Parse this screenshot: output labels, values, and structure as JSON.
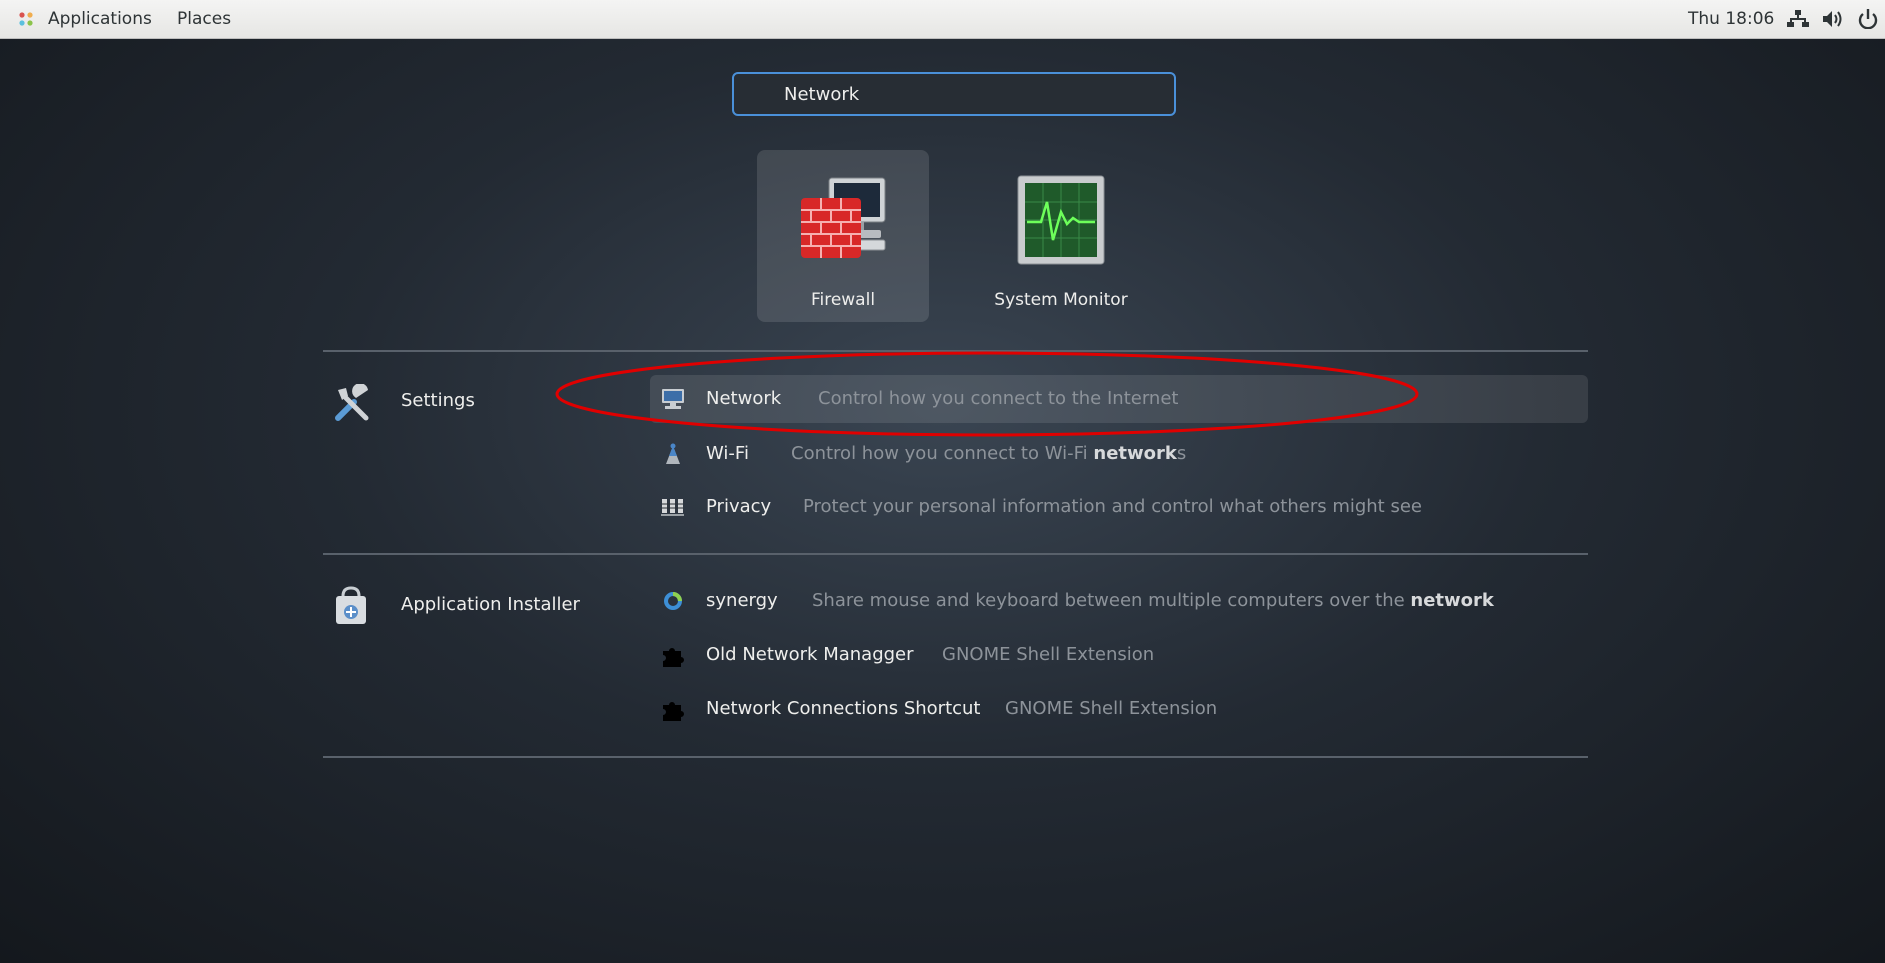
{
  "topbar": {
    "applications_label": "Applications",
    "places_label": "Places",
    "clock": "Thu 18:06"
  },
  "search": {
    "value": "Network"
  },
  "apps": [
    {
      "label": "Firewall",
      "icon": "firewall-icon"
    },
    {
      "label": "System Monitor",
      "icon": "system-monitor-icon"
    }
  ],
  "providers": [
    {
      "name": "Settings",
      "icon": "settings-icon",
      "results": [
        {
          "name": "Network",
          "description": "Control how you connect to the Internet",
          "icon": "network-icon"
        },
        {
          "name": "Wi-Fi",
          "description_prefix": "Control how you connect to Wi-Fi ",
          "description_match": "network",
          "description_suffix": "s",
          "icon": "wifi-icon"
        },
        {
          "name": "Privacy",
          "description": "Protect your personal information and control what others might see",
          "icon": "privacy-icon"
        }
      ]
    },
    {
      "name": "Application Installer",
      "icon": "application-installer-icon",
      "results": [
        {
          "name": "synergy",
          "description_prefix": "Share mouse and keyboard between multiple computers over the ",
          "description_match": "network",
          "icon": "synergy-icon"
        },
        {
          "name": "Old Network Managger",
          "description": "GNOME Shell Extension",
          "icon": "extension-icon"
        },
        {
          "name": "Network Connections Shortcut",
          "description": "GNOME Shell Extension",
          "icon": "extension-icon"
        }
      ]
    }
  ],
  "colors": {
    "search_focus": "#4a90d9",
    "annotation": "#e00000"
  }
}
